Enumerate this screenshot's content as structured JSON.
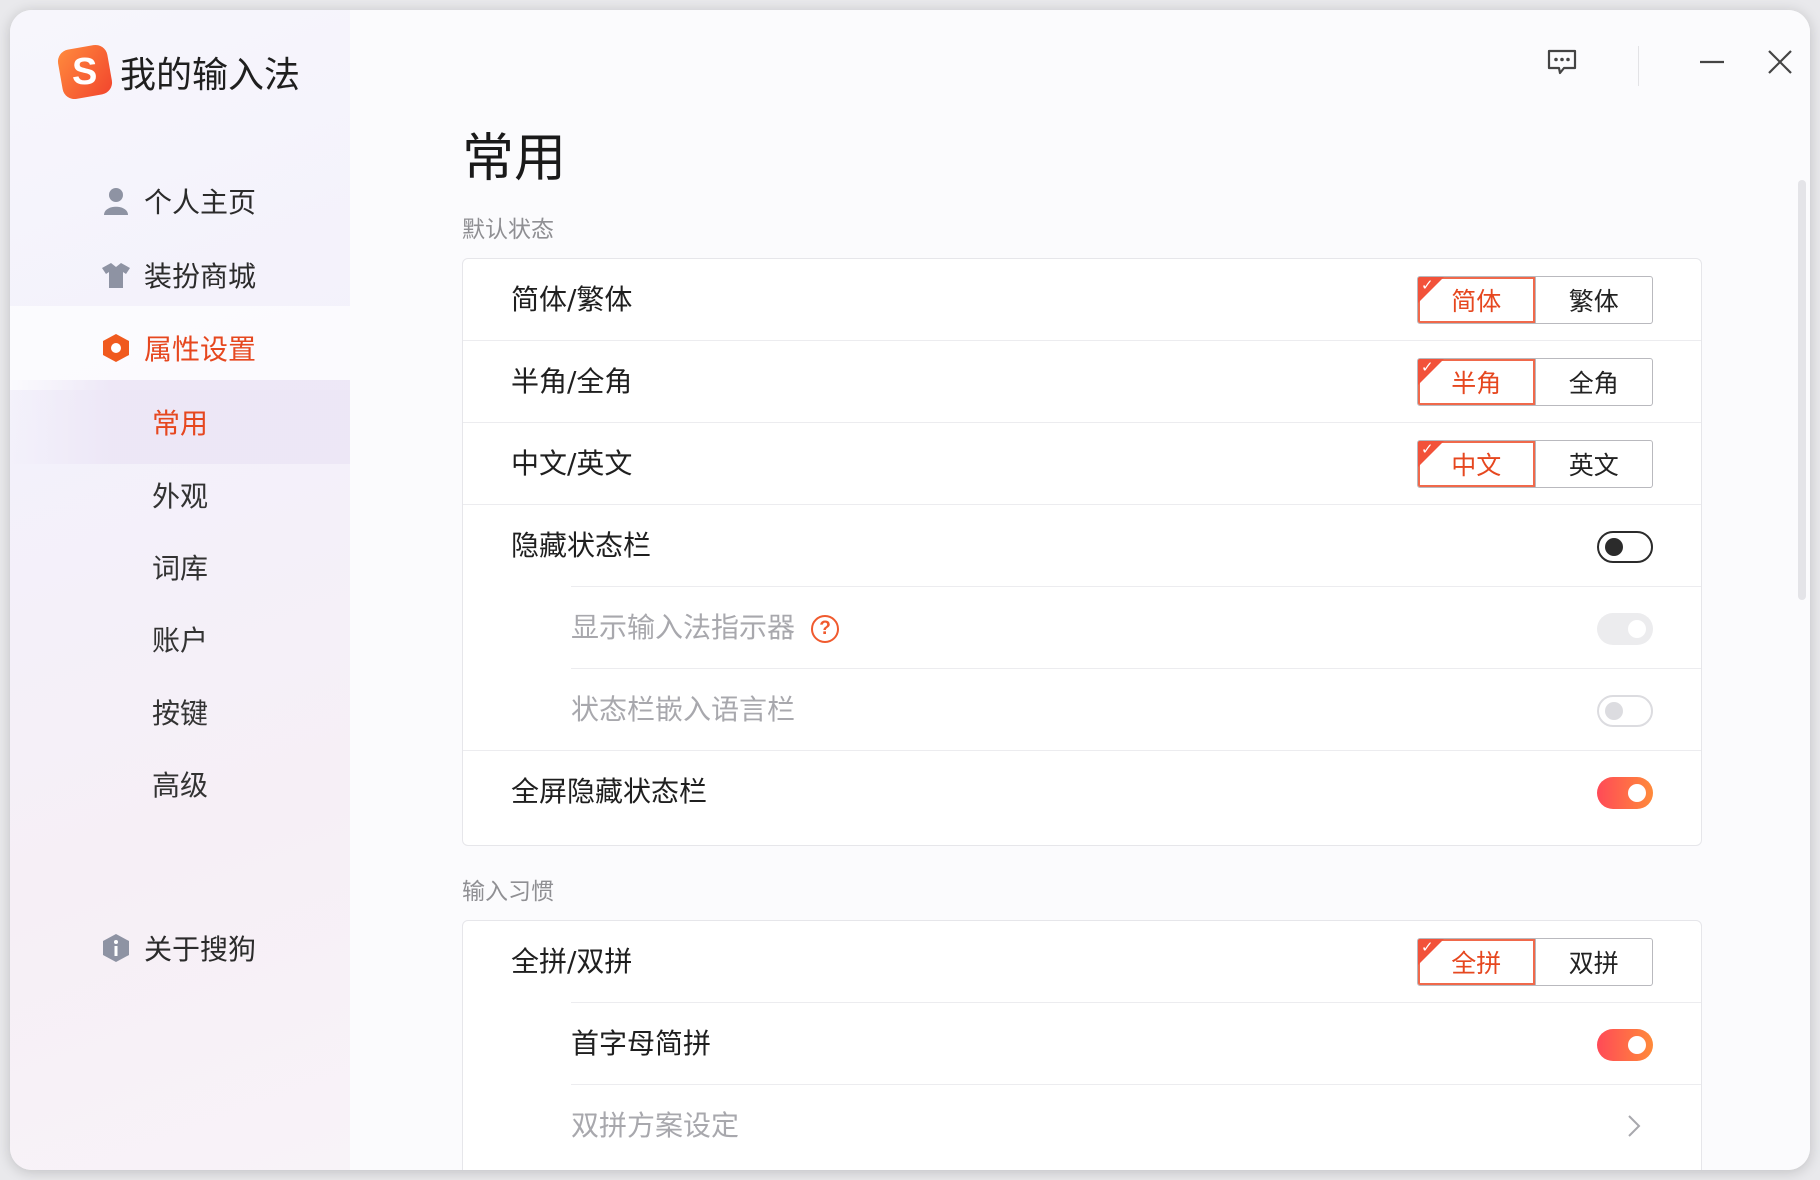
{
  "app": {
    "name": "我的输入法",
    "logo_letter": "S"
  },
  "sidebar": {
    "items": [
      {
        "label": "个人主页",
        "icon": "user-icon"
      },
      {
        "label": "装扮商城",
        "icon": "shirt-icon"
      },
      {
        "label": "属性设置",
        "icon": "settings-hexagon-icon",
        "active": true
      }
    ],
    "sub_items": [
      {
        "label": "常用",
        "selected": true
      },
      {
        "label": "外观"
      },
      {
        "label": "词库"
      },
      {
        "label": "账户"
      },
      {
        "label": "按键"
      },
      {
        "label": "高级"
      }
    ],
    "about": {
      "label": "关于搜狗",
      "icon": "info-icon"
    }
  },
  "titlebar": {
    "buttons": [
      "feedback-icon",
      "minimize-icon",
      "close-icon"
    ]
  },
  "page": {
    "title": "常用"
  },
  "sections": [
    {
      "label": "默认状态",
      "rows": [
        {
          "label": "简体/繁体",
          "control": "segmented",
          "options": [
            "简体",
            "繁体"
          ],
          "selected": 0
        },
        {
          "label": "半角/全角",
          "control": "segmented",
          "options": [
            "半角",
            "全角"
          ],
          "selected": 0
        },
        {
          "label": "中文/英文",
          "control": "segmented",
          "options": [
            "中文",
            "英文"
          ],
          "selected": 0
        },
        {
          "label": "隐藏状态栏",
          "control": "toggle",
          "value": false
        },
        {
          "label": "显示输入法指示器",
          "control": "toggle",
          "value": true,
          "disabled": true,
          "help": "?"
        },
        {
          "label": "状态栏嵌入语言栏",
          "control": "toggle",
          "value": false,
          "disabled": true
        },
        {
          "label": "全屏隐藏状态栏",
          "control": "toggle",
          "value": true
        }
      ]
    },
    {
      "label": "输入习惯",
      "rows": [
        {
          "label": "全拼/双拼",
          "control": "segmented",
          "options": [
            "全拼",
            "双拼"
          ],
          "selected": 0
        },
        {
          "label": "首字母简拼",
          "control": "toggle",
          "value": true
        },
        {
          "label": "双拼方案设定",
          "control": "link",
          "disabled": true
        }
      ]
    }
  ],
  "colors": {
    "accent": "#e6471f",
    "toggle_on_start": "#ff4a57",
    "toggle_on_end": "#ff8a3a"
  }
}
